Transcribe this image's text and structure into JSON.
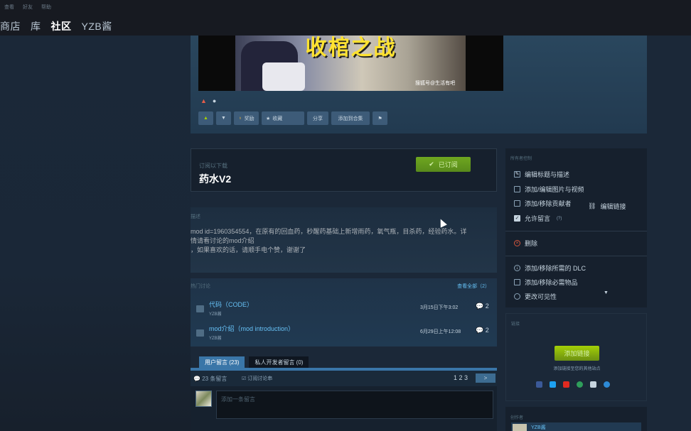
{
  "system_menu": [
    "查看",
    "好友",
    "帮助"
  ],
  "nav": {
    "store": "商店",
    "library": "库",
    "community": "社区",
    "user": "YZB酱"
  },
  "media": {
    "video_caption": "收棺之战",
    "video_subtitle": "搜狐号@生活有吧"
  },
  "actions": {
    "award": "奖励",
    "favorite": "收藏",
    "share": "分享",
    "add_to_collection": "添加到合集"
  },
  "item": {
    "label": "订阅以下载",
    "title": "药水V2",
    "subscribed_label": "已订阅"
  },
  "description": {
    "label": "描述",
    "line1": "mod id=1960354554，在原有的回血药，秒醒药基础上新增雨药，氧气瓶，目杀药，经验药水。详",
    "line2": "情请看讨论的mod介绍",
    "line3": "，如果喜欢的话，请顺手电个赞，谢谢了"
  },
  "guides": {
    "label": "热门讨论",
    "see_all": "查看全部（2）",
    "items": [
      {
        "title": "代码（CODE）",
        "author": "YZB酱",
        "date": "3月15日下午3:02",
        "count": "2"
      },
      {
        "title": "mod介绍（mod introduction）",
        "author": "YZB酱",
        "date": "6月29日上午12:08",
        "count": "2"
      }
    ]
  },
  "comments": {
    "tab_user": "用户留言 (23)",
    "tab_dev": "私人开发者留言 (0)",
    "count_text": "23 条留言",
    "subscribe_thread": "订阅讨论串",
    "pages": "1 2 3",
    "next": ">",
    "placeholder": "添加一条留言"
  },
  "owner_controls": {
    "header": "所有者控制",
    "edit_title": "编辑标题与描述",
    "add_media": "添加/编辑图片与视频",
    "contributors": "添加/移除贡献者",
    "edit_links": "编辑链接",
    "allow_comments": "允许留言",
    "allow_comments_hint": "(?)",
    "delete": "删除",
    "dlc": "添加/移除所需的 DLC",
    "required_items": "添加/移除必需物品",
    "visibility": "更改可见性"
  },
  "links": {
    "header": "链接",
    "add_link": "添加链接",
    "note": "添加链接至您的其他站点"
  },
  "creator": {
    "header": "创作者",
    "name": "YZB酱"
  },
  "colors": {
    "accent_blue": "#66c0f4",
    "subscribe_green": "#6fa720",
    "background": "#1b2838"
  }
}
